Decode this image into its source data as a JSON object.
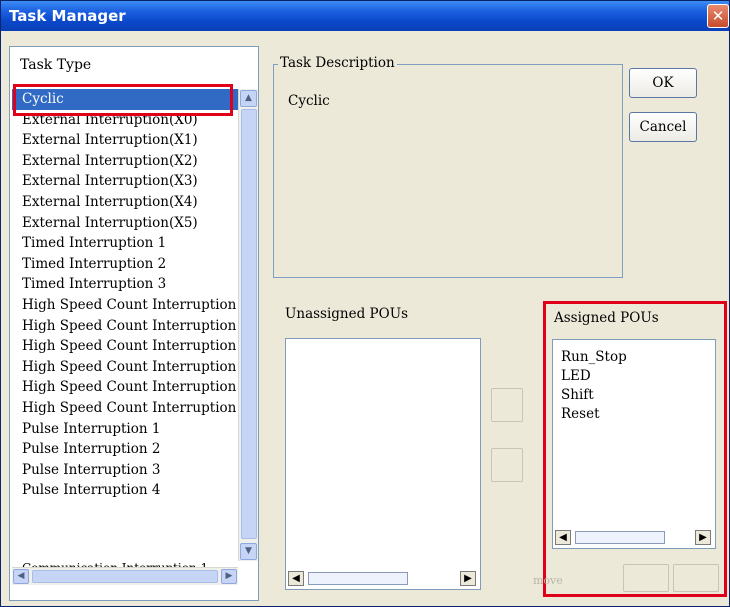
{
  "window": {
    "title": "Task Manager",
    "close_glyph": "✕"
  },
  "task_type": {
    "label": "Task Type",
    "items": [
      "Cyclic",
      "External Interruption(X0)",
      "External Interruption(X1)",
      "External Interruption(X2)",
      "External Interruption(X3)",
      "External Interruption(X4)",
      "External Interruption(X5)",
      "Timed Interruption 1",
      "Timed Interruption 2",
      "Timed Interruption 3",
      "High Speed Count Interruption",
      "High Speed Count Interruption",
      "High Speed Count Interruption",
      "High Speed Count Interruption",
      "High Speed Count Interruption",
      "High Speed Count Interruption",
      "Pulse Interruption 1",
      "Pulse Interruption 2",
      "Pulse Interruption 3",
      "Pulse Interruption 4"
    ],
    "partial_item": "Communication Interruption 1",
    "selected_index": 0
  },
  "description": {
    "label": "Task Description",
    "text": "Cyclic"
  },
  "buttons": {
    "ok": "OK",
    "cancel": "Cancel",
    "move": "move"
  },
  "pous": {
    "unassigned_label": "Unassigned POUs",
    "assigned_label": "Assigned POUs",
    "assigned": [
      "Run_Stop",
      "LED",
      "Shift",
      "Reset"
    ]
  },
  "colors": {
    "selection": "#316ac5",
    "highlight": "#e0001a",
    "title_bar": "#0a47c8"
  },
  "icons": {
    "scroll_up": "chevron-up-icon",
    "scroll_down": "chevron-down-icon",
    "scroll_left": "triangle-left-icon",
    "scroll_right": "triangle-right-icon"
  }
}
